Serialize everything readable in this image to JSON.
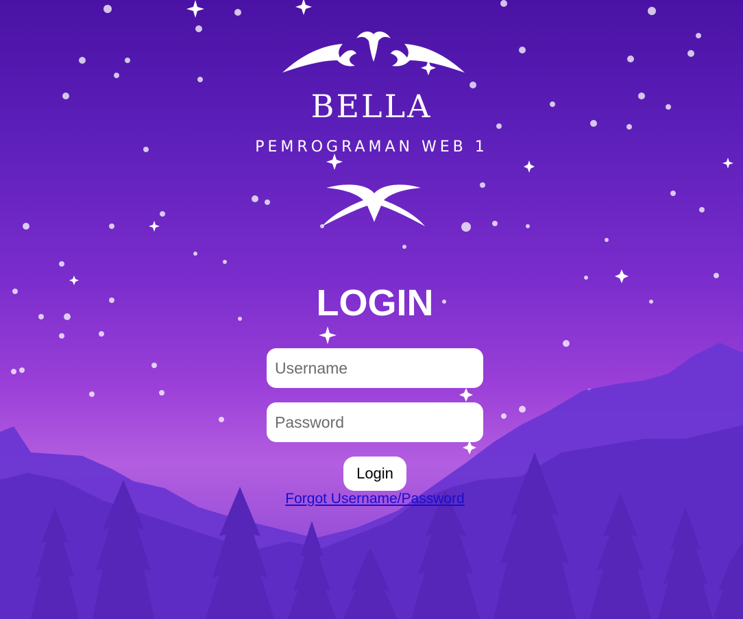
{
  "brand": {
    "name": "BELLA",
    "subtitle": "PEMROGRAMAN WEB 1"
  },
  "login": {
    "title": "LOGIN",
    "username_placeholder": "Username",
    "password_placeholder": "Password",
    "submit_label": "Login",
    "forgot_link": "Forgot Username/Password"
  },
  "colors": {
    "sky_top": "#4a12a4",
    "sky_bottom": "#b35ee0",
    "mountains": "#6a35d0",
    "trees": "#5424b4",
    "link": "#1a0dcc"
  }
}
